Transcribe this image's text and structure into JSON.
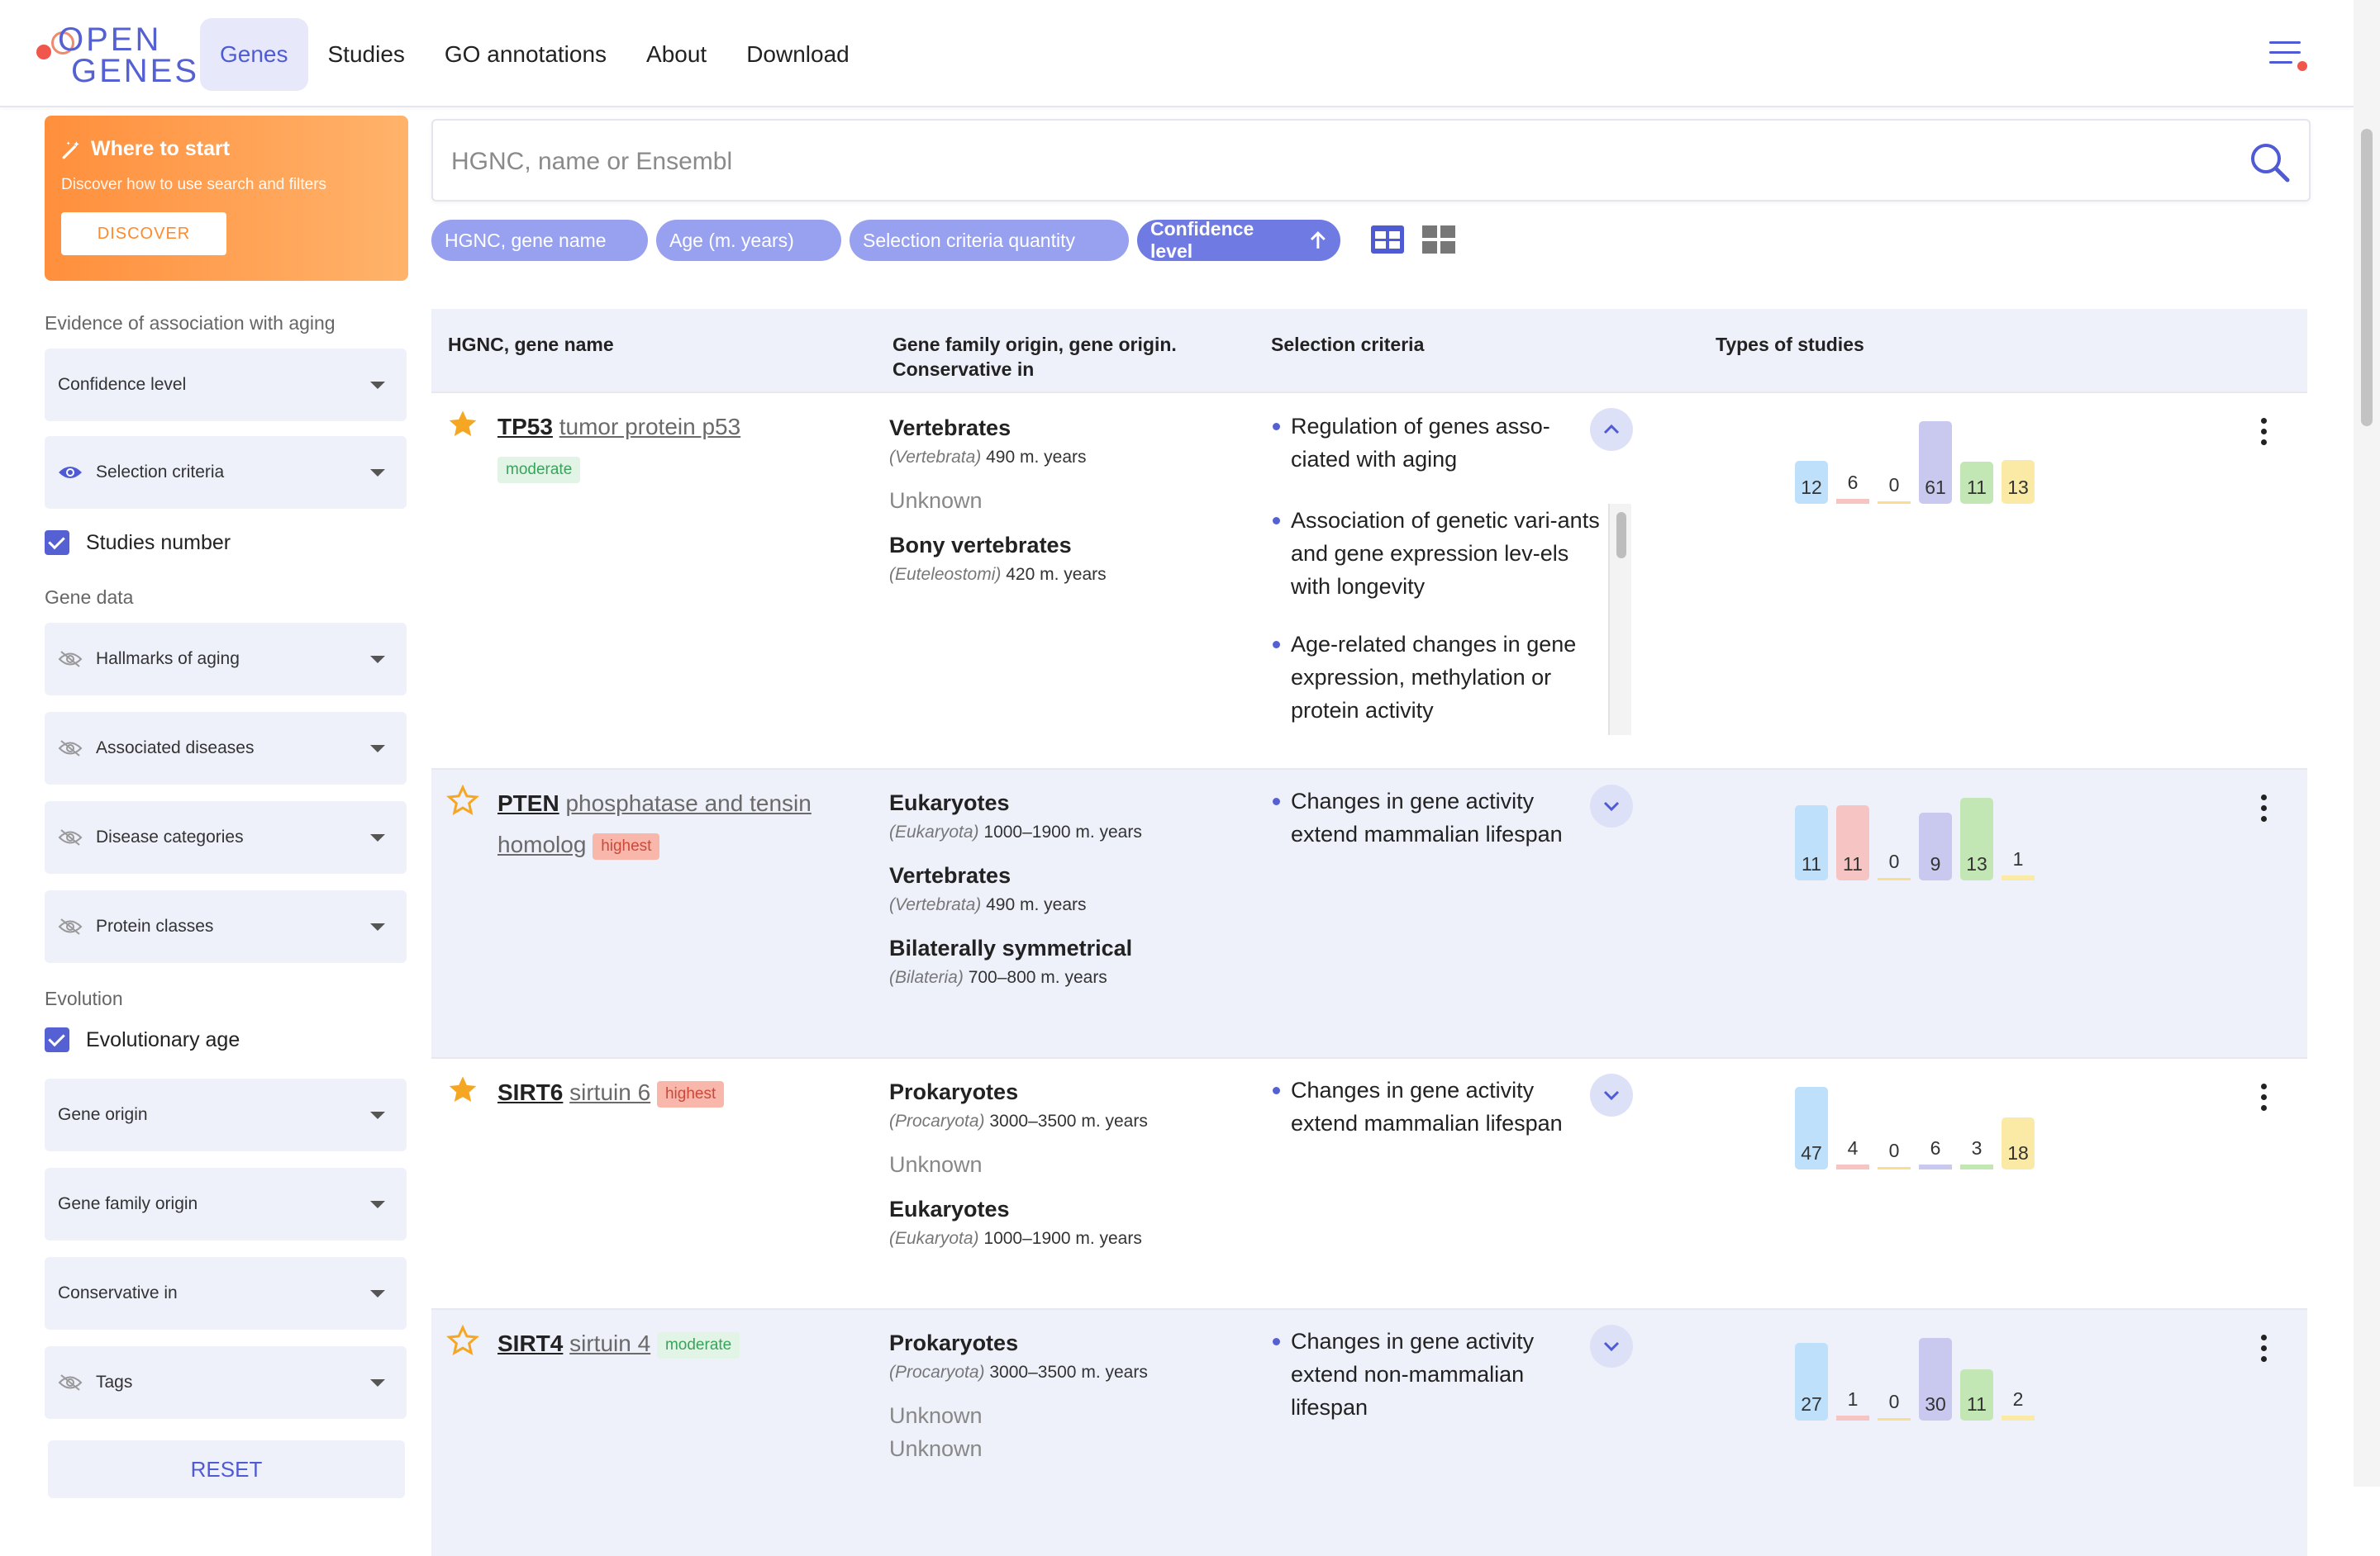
{
  "header": {
    "logo_line1": "OPEN",
    "logo_line2": "GENES",
    "nav": [
      "Genes",
      "Studies",
      "GO annotations",
      "About",
      "Download"
    ]
  },
  "promo": {
    "title": "Where to start",
    "desc": "Discover how to use search and filters",
    "button": "DISCOVER"
  },
  "sidebar": {
    "section_evidence": "Evidence of association with aging",
    "confidence_level": "Confidence level",
    "selection_criteria": "Selection criteria",
    "studies_number": "Studies number",
    "section_gene_data": "Gene data",
    "hallmarks": "Hallmarks of aging",
    "diseases": "Associated diseases",
    "disease_categories": "Disease categories",
    "protein_classes": "Protein classes",
    "section_evolution": "Evolution",
    "evolutionary_age": "Evolutionary age",
    "gene_origin": "Gene origin",
    "gene_family_origin": "Gene family origin",
    "conservative_in": "Conservative in",
    "tags": "Tags",
    "reset": "RESET"
  },
  "search": {
    "placeholder": "HGNC, name or Ensembl"
  },
  "chips": [
    "HGNC, gene name",
    "Age (m. years)",
    "Selection criteria quantity",
    "Confidence level"
  ],
  "table": {
    "headers": {
      "gene": "HGNC, gene name",
      "origin": "Gene family origin, gene origin. Conservative in",
      "criteria": "Selection criteria",
      "studies": "Types of studies"
    },
    "rows": [
      {
        "symbol": "TP53",
        "name": "tumor protein p53",
        "badge": "moderate",
        "origins": [
          {
            "name": "Vertebrates",
            "latin": "(Vertebrata)",
            "age": "490 m. years"
          },
          {
            "unknown": "Unknown"
          },
          {
            "name": "Bony vertebrates",
            "latin": "(Euteleostomi)",
            "age": "420 m. years"
          }
        ],
        "criteria": [
          "Regulation of genes asso-ciated with aging",
          "Association of genetic vari-ants and gene expression lev-els with longevity",
          "Age-related changes in gene expression, methylation or protein activity"
        ],
        "studies": [
          12,
          6,
          0,
          61,
          11,
          13
        ]
      },
      {
        "symbol": "PTEN",
        "name": "phosphatase and tensin homolog",
        "badge": "highest",
        "origins": [
          {
            "name": "Eukaryotes",
            "latin": "(Eukaryota)",
            "age": "1000–1900 m. years"
          },
          {
            "name": "Vertebrates",
            "latin": "(Vertebrata)",
            "age": "490 m. years"
          },
          {
            "name": "Bilaterally symmetrical",
            "latin": "(Bilateria)",
            "age": "700–800 m. years"
          }
        ],
        "criteria": [
          "Changes in gene activity extend mammalian lifespan"
        ],
        "studies": [
          11,
          11,
          0,
          9,
          13,
          1
        ]
      },
      {
        "symbol": "SIRT6",
        "name": "sirtuin 6",
        "badge": "highest",
        "origins": [
          {
            "name": "Prokaryotes",
            "latin": "(Procaryota)",
            "age": "3000–3500 m. years"
          },
          {
            "unknown": "Unknown"
          },
          {
            "name": "Eukaryotes",
            "latin": "(Eukaryota)",
            "age": "1000–1900 m. years"
          }
        ],
        "criteria": [
          "Changes in gene activity extend mammalian lifespan"
        ],
        "studies": [
          47,
          4,
          0,
          6,
          3,
          18
        ]
      },
      {
        "symbol": "SIRT4",
        "name": "sirtuin 4",
        "badge": "moderate",
        "origins": [
          {
            "name": "Prokaryotes",
            "latin": "(Procaryota)",
            "age": "3000–3500 m. years"
          },
          {
            "unknown": "Unknown"
          },
          {
            "unknown": "Unknown"
          }
        ],
        "criteria": [
          "Changes in gene activity extend non-mammalian lifespan"
        ],
        "studies": [
          27,
          1,
          0,
          30,
          11,
          2
        ]
      }
    ]
  },
  "colors": {
    "accent": "#5561d3",
    "study_bar_colors": [
      "#bfe0fb",
      "#f7c4c4",
      "#fbe5a8",
      "#c9c8ee",
      "#c3e6b5",
      "#fbe9a6"
    ],
    "study_bar_line_colors": [
      "#a8d4f7",
      "#f2a5a5",
      "#f9dd92",
      "#b5b3e6",
      "#9fd889",
      "#f8dd80"
    ]
  }
}
